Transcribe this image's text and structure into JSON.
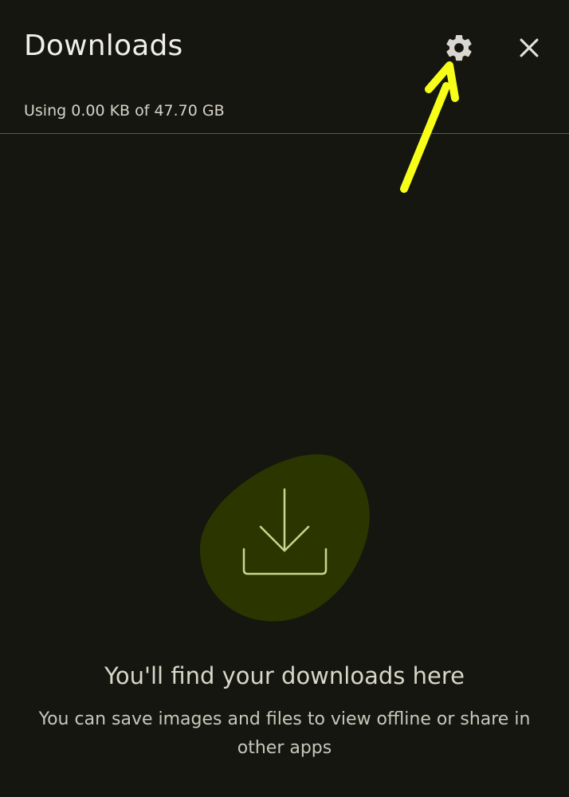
{
  "header": {
    "title": "Downloads",
    "settings_icon": "gear-icon",
    "close_icon": "close-icon"
  },
  "storage": {
    "text": "Using 0.00 KB of 47.70 GB"
  },
  "empty_state": {
    "icon": "download-icon",
    "title": "You'll find your downloads here",
    "description": "You can save images and files to view offline or share in other apps"
  },
  "annotation": {
    "icon": "arrow-pointer-icon",
    "color": "#f7ff18"
  },
  "colors": {
    "background": "#151610",
    "text": "#f1efe6",
    "muted_text": "#c9c7bb",
    "divider": "#5b5a52",
    "illustration_bg": "#2b3500",
    "illustration_icon": "#cbd58f"
  }
}
